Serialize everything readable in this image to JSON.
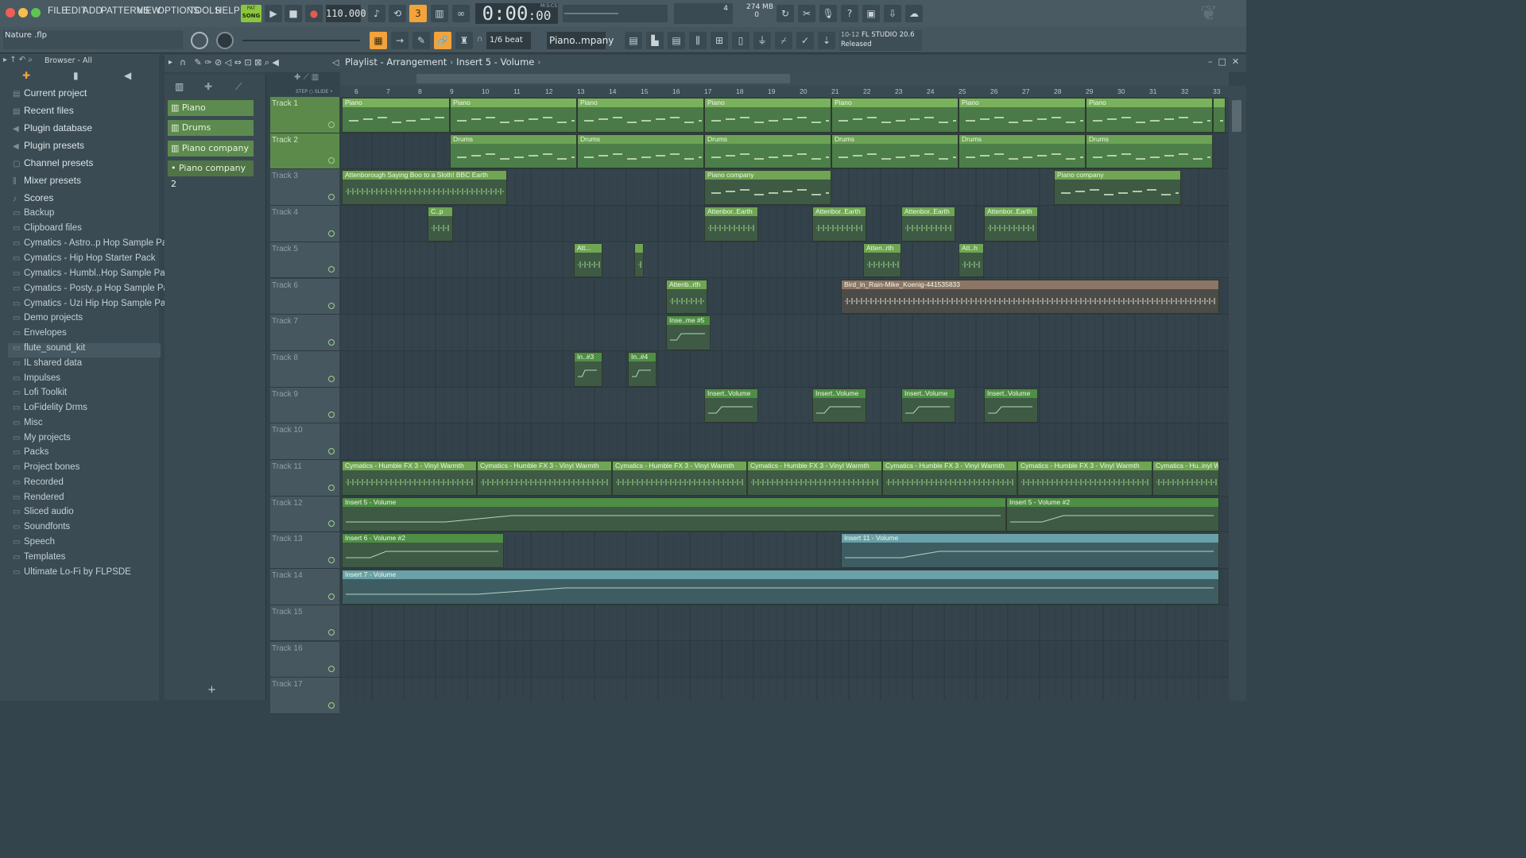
{
  "menu": [
    "FILE",
    "EDIT",
    "ADD",
    "PATTERNS",
    "VIEW",
    "OPTIONS",
    "TOOLS",
    "HELP"
  ],
  "transport": {
    "mode_pat": "PAT",
    "mode_song": "SONG",
    "tempo": "110.000",
    "time": "0:00",
    "time_sub": ":00",
    "time_unit": "M:S:CS"
  },
  "info": {
    "cpu_num": "4",
    "ram": "274 MB",
    "ram_sub": "0"
  },
  "snap": "1/6 beat",
  "channel_selector": "Piano..mpany",
  "news": {
    "date": "10-12",
    "title": "FL STUDIO 20.6",
    "status": "Released"
  },
  "project_hint": "Nature .flp",
  "browser": {
    "title": "Browser - All",
    "items": [
      {
        "label": "Current project",
        "icon": "project-icon"
      },
      {
        "label": "Recent files",
        "icon": "recent-icon"
      },
      {
        "label": "Plugin database",
        "icon": "plugin-icon"
      },
      {
        "label": "Plugin presets",
        "icon": "preset-icon"
      },
      {
        "label": "Channel presets",
        "icon": "channel-icon"
      },
      {
        "label": "Mixer presets",
        "icon": "mixer-icon"
      },
      {
        "label": "Scores",
        "icon": "note-icon"
      },
      {
        "label": "Backup",
        "icon": "folder-icon"
      },
      {
        "label": "Clipboard files",
        "icon": "folder-icon"
      },
      {
        "label": "Cymatics - Astro..p Hop Sample Pack",
        "icon": "folder-icon"
      },
      {
        "label": "Cymatics - Hip Hop Starter Pack",
        "icon": "folder-icon"
      },
      {
        "label": "Cymatics - Humbl..Hop Sample Pack",
        "icon": "folder-icon"
      },
      {
        "label": "Cymatics - Posty..p Hop Sample Pack",
        "icon": "folder-icon"
      },
      {
        "label": "Cymatics - Uzi Hip Hop Sample Pack",
        "icon": "folder-icon"
      },
      {
        "label": "Demo projects",
        "icon": "folder-icon"
      },
      {
        "label": "Envelopes",
        "icon": "folder-icon"
      },
      {
        "label": "flute_sound_kit",
        "icon": "folder-icon"
      },
      {
        "label": "IL shared data",
        "icon": "folder-icon"
      },
      {
        "label": "Impulses",
        "icon": "folder-icon"
      },
      {
        "label": "Lofi Toolkit",
        "icon": "folder-icon"
      },
      {
        "label": "LoFidelity Drms",
        "icon": "folder-icon"
      },
      {
        "label": "Misc",
        "icon": "folder-icon"
      },
      {
        "label": "My projects",
        "icon": "folder-icon"
      },
      {
        "label": "Packs",
        "icon": "folder-icon"
      },
      {
        "label": "Project bones",
        "icon": "folder-icon"
      },
      {
        "label": "Recorded",
        "icon": "folder-icon"
      },
      {
        "label": "Rendered",
        "icon": "folder-icon"
      },
      {
        "label": "Sliced audio",
        "icon": "folder-icon"
      },
      {
        "label": "Soundfonts",
        "icon": "folder-icon"
      },
      {
        "label": "Speech",
        "icon": "folder-icon"
      },
      {
        "label": "Templates",
        "icon": "folder-icon"
      },
      {
        "label": "Ultimate Lo-Fi by FLPSDE",
        "icon": "folder-icon"
      }
    ]
  },
  "playlist": {
    "breadcrumb": [
      "Playlist - Arrangement",
      "Insert 5 - Volume"
    ],
    "patterns": [
      "Piano",
      "Drums",
      "Piano company",
      "Piano company 2"
    ],
    "bars": [
      "6",
      "7",
      "8",
      "9",
      "10",
      "11",
      "12",
      "13",
      "14",
      "15",
      "16",
      "17",
      "18",
      "19",
      "20",
      "21",
      "22",
      "23",
      "24",
      "25",
      "26",
      "27",
      "28",
      "29",
      "30",
      "31",
      "32",
      "33"
    ],
    "tracks": [
      "Track 1",
      "Track 2",
      "Track 3",
      "Track 4",
      "Track 5",
      "Track 6",
      "Track 7",
      "Track 8",
      "Track 9",
      "Track 10",
      "Track 11",
      "Track 12",
      "Track 13",
      "Track 14",
      "Track 15",
      "Track 16",
      "Track 17"
    ]
  },
  "clips": [
    {
      "track": 0,
      "start": 6,
      "len": 3.4,
      "label": "Piano",
      "kind": "piano"
    },
    {
      "track": 0,
      "start": 9.4,
      "len": 4,
      "label": "Piano",
      "kind": "piano"
    },
    {
      "track": 0,
      "start": 13.4,
      "len": 4,
      "label": "Piano",
      "kind": "piano"
    },
    {
      "track": 0,
      "start": 17.4,
      "len": 4,
      "label": "Piano",
      "kind": "piano"
    },
    {
      "track": 0,
      "start": 21.4,
      "len": 4,
      "label": "Piano",
      "kind": "piano"
    },
    {
      "track": 0,
      "start": 25.4,
      "len": 4,
      "label": "Piano",
      "kind": "piano"
    },
    {
      "track": 0,
      "start": 29.4,
      "len": 4,
      "label": "Piano",
      "kind": "piano"
    },
    {
      "track": 0,
      "start": 33.4,
      "len": 0.4,
      "label": "",
      "kind": "piano"
    },
    {
      "track": 1,
      "start": 9.4,
      "len": 4,
      "label": "Drums",
      "kind": "drums"
    },
    {
      "track": 1,
      "start": 13.4,
      "len": 4,
      "label": "Drums",
      "kind": "drums"
    },
    {
      "track": 1,
      "start": 17.4,
      "len": 4,
      "label": "Drums",
      "kind": "drums"
    },
    {
      "track": 1,
      "start": 21.4,
      "len": 4,
      "label": "Drums",
      "kind": "drums"
    },
    {
      "track": 1,
      "start": 25.4,
      "len": 4,
      "label": "Drums",
      "kind": "drums"
    },
    {
      "track": 1,
      "start": 29.4,
      "len": 4,
      "label": "Drums",
      "kind": "drums"
    },
    {
      "track": 2,
      "start": 6,
      "len": 5.2,
      "label": "Attenborough Saying Boo to a Sloth! BBC Earth",
      "kind": "audio"
    },
    {
      "track": 2,
      "start": 17.4,
      "len": 4,
      "label": "Piano company",
      "kind": "pat"
    },
    {
      "track": 2,
      "start": 28.4,
      "len": 4,
      "label": "Piano company",
      "kind": "pat"
    },
    {
      "track": 3,
      "start": 8.7,
      "len": 0.8,
      "label": "C..p",
      "kind": "audio"
    },
    {
      "track": 3,
      "start": 17.4,
      "len": 1.7,
      "label": "Attenbor..Earth",
      "kind": "audio"
    },
    {
      "track": 3,
      "start": 20.8,
      "len": 1.7,
      "label": "Attenbor..Earth",
      "kind": "audio"
    },
    {
      "track": 3,
      "start": 23.6,
      "len": 1.7,
      "label": "Attenbor..Earth",
      "kind": "audio"
    },
    {
      "track": 3,
      "start": 26.2,
      "len": 1.7,
      "label": "Attenbor..Earth",
      "kind": "audio"
    },
    {
      "track": 4,
      "start": 13.3,
      "len": 0.9,
      "label": "Att...",
      "kind": "audio"
    },
    {
      "track": 4,
      "start": 15.2,
      "len": 0.3,
      "label": "",
      "kind": "audio"
    },
    {
      "track": 4,
      "start": 22.4,
      "len": 1.2,
      "label": "Atten..rth",
      "kind": "audio"
    },
    {
      "track": 4,
      "start": 25.4,
      "len": 0.8,
      "label": "Att..h",
      "kind": "audio"
    },
    {
      "track": 5,
      "start": 16.2,
      "len": 1.3,
      "label": "Attenb..rth",
      "kind": "audio"
    },
    {
      "track": 5,
      "start": 21.7,
      "len": 11.9,
      "label": "Bird_in_Rain-Mike_Koenig-441535833",
      "kind": "brown"
    },
    {
      "track": 6,
      "start": 16.2,
      "len": 1.4,
      "label": "Inse..me #5",
      "kind": "auto"
    },
    {
      "track": 7,
      "start": 13.3,
      "len": 0.9,
      "label": "In..#3",
      "kind": "auto"
    },
    {
      "track": 7,
      "start": 15.0,
      "len": 0.9,
      "label": "In..#4",
      "kind": "auto"
    },
    {
      "track": 8,
      "start": 17.4,
      "len": 1.7,
      "label": "Insert..Volume",
      "kind": "auto"
    },
    {
      "track": 8,
      "start": 20.8,
      "len": 1.7,
      "label": "Insert..Volume",
      "kind": "auto"
    },
    {
      "track": 8,
      "start": 23.6,
      "len": 1.7,
      "label": "Insert..Volume",
      "kind": "auto"
    },
    {
      "track": 8,
      "start": 26.2,
      "len": 1.7,
      "label": "Insert..Volume",
      "kind": "auto"
    },
    {
      "track": 10,
      "start": 6,
      "len": 4.25,
      "label": "Cymatics - Humble FX 3 - Vinyl Warmth",
      "kind": "audio"
    },
    {
      "track": 10,
      "start": 10.25,
      "len": 4.25,
      "label": "Cymatics - Humble FX 3 - Vinyl Warmth",
      "kind": "audio"
    },
    {
      "track": 10,
      "start": 14.5,
      "len": 4.25,
      "label": "Cymatics - Humble FX 3 - Vinyl Warmth",
      "kind": "audio"
    },
    {
      "track": 10,
      "start": 18.75,
      "len": 4.25,
      "label": "Cymatics - Humble FX 3 - Vinyl Warmth",
      "kind": "audio"
    },
    {
      "track": 10,
      "start": 23,
      "len": 4.25,
      "label": "Cymatics - Humble FX 3 - Vinyl Warmth",
      "kind": "audio"
    },
    {
      "track": 10,
      "start": 27.25,
      "len": 4.25,
      "label": "Cymatics - Humble FX 3 - Vinyl Warmth",
      "kind": "audio"
    },
    {
      "track": 10,
      "start": 31.5,
      "len": 2.1,
      "label": "Cymatics - Hu..inyl Warmth",
      "kind": "audio"
    },
    {
      "track": 11,
      "start": 6,
      "len": 20.9,
      "label": "Insert 5 - Volume",
      "kind": "auto"
    },
    {
      "track": 11,
      "start": 26.9,
      "len": 6.7,
      "label": "Insert 5 - Volume #2",
      "kind": "auto"
    },
    {
      "track": 12,
      "start": 6,
      "len": 5.1,
      "label": "Insert 6 - Volume #2",
      "kind": "auto"
    },
    {
      "track": 12,
      "start": 21.7,
      "len": 11.9,
      "label": "Insert 11 - Volume",
      "kind": "teal"
    },
    {
      "track": 13,
      "start": 6,
      "len": 27.6,
      "label": "Insert 7 - Volume",
      "kind": "teal"
    }
  ],
  "colors": {
    "accent": "#f2a33a",
    "clip_green": "#6fa553",
    "clip_teal": "#6aa0a8",
    "clip_brown": "#8c7565"
  }
}
